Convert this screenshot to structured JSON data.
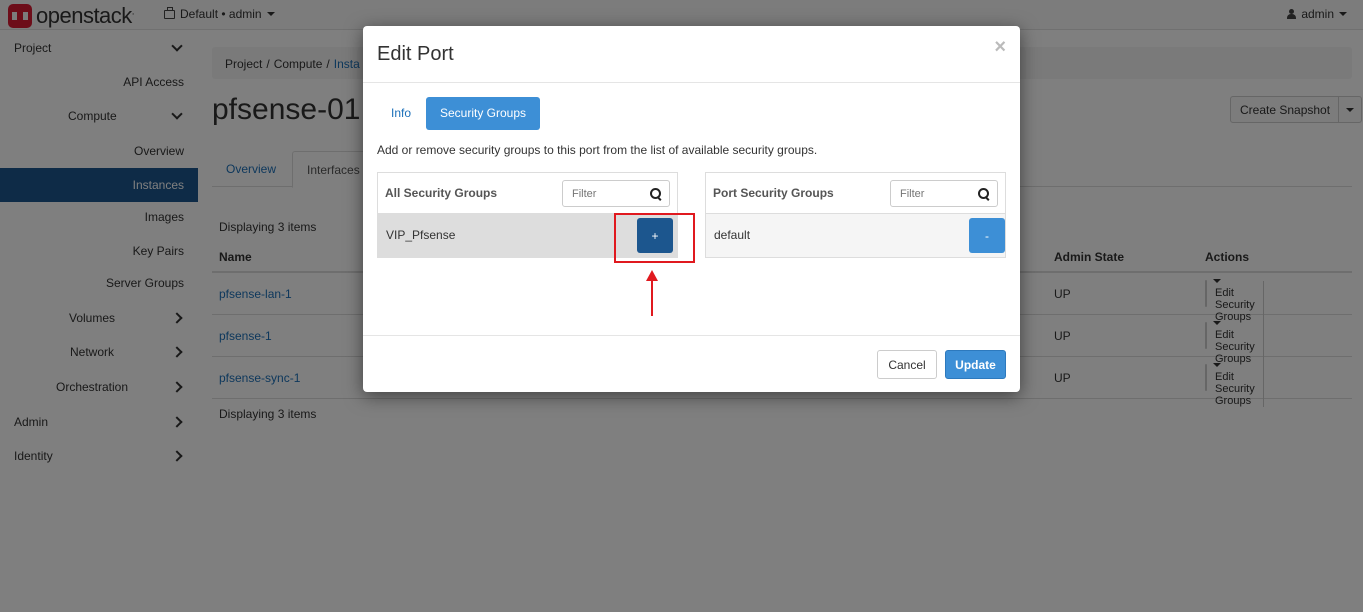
{
  "header": {
    "brand": "openstack",
    "brand_mark": ".",
    "project_picker": "Default • admin",
    "user": "admin"
  },
  "sidebar": {
    "items": [
      {
        "label": "Project",
        "chevron": "down"
      },
      {
        "label": "API Access"
      },
      {
        "label": "Compute",
        "chevron": "down"
      },
      {
        "label": "Overview"
      },
      {
        "label": "Instances",
        "active": true
      },
      {
        "label": "Images"
      },
      {
        "label": "Key Pairs"
      },
      {
        "label": "Server Groups"
      },
      {
        "label": "Volumes",
        "chevron": "right"
      },
      {
        "label": "Network",
        "chevron": "right"
      },
      {
        "label": "Orchestration",
        "chevron": "right"
      },
      {
        "label": "Admin",
        "chevron": "right"
      },
      {
        "label": "Identity",
        "chevron": "right"
      }
    ]
  },
  "breadcrumb": {
    "items": [
      "Project",
      "/",
      "Compute",
      "/",
      "Insta"
    ]
  },
  "page": {
    "title": "pfsense-01",
    "create_snapshot": "Create Snapshot"
  },
  "tabs": [
    "Overview",
    "Interfaces"
  ],
  "table": {
    "display_count": "Displaying 3 items",
    "columns": {
      "name": "Name",
      "admin_state": "Admin State",
      "actions": "Actions"
    },
    "rows": [
      {
        "name": "pfsense-lan-1",
        "admin_state": "UP",
        "action": "Edit Security Groups"
      },
      {
        "name": "pfsense-1",
        "admin_state": "UP",
        "action": "Edit Security Groups"
      },
      {
        "name": "pfsense-sync-1",
        "admin_state": "UP",
        "action": "Edit Security Groups"
      }
    ]
  },
  "modal": {
    "title": "Edit Port",
    "close": "×",
    "tabs": {
      "info": "Info",
      "security_groups": "Security Groups"
    },
    "help": "Add or remove security groups to this port from the list of available security groups.",
    "all_groups": {
      "label": "All Security Groups",
      "filter_placeholder": "Filter",
      "items": [
        {
          "name": "VIP_Pfsense",
          "button": "+"
        }
      ]
    },
    "port_groups": {
      "label": "Port Security Groups",
      "filter_placeholder": "Filter",
      "items": [
        {
          "name": "default",
          "button": "-"
        }
      ]
    },
    "cancel": "Cancel",
    "update": "Update"
  },
  "colors": {
    "accent": "#3d8fd6",
    "active_nav": "#1c568e",
    "link": "#1c70b9",
    "highlight": "#e0191f"
  }
}
